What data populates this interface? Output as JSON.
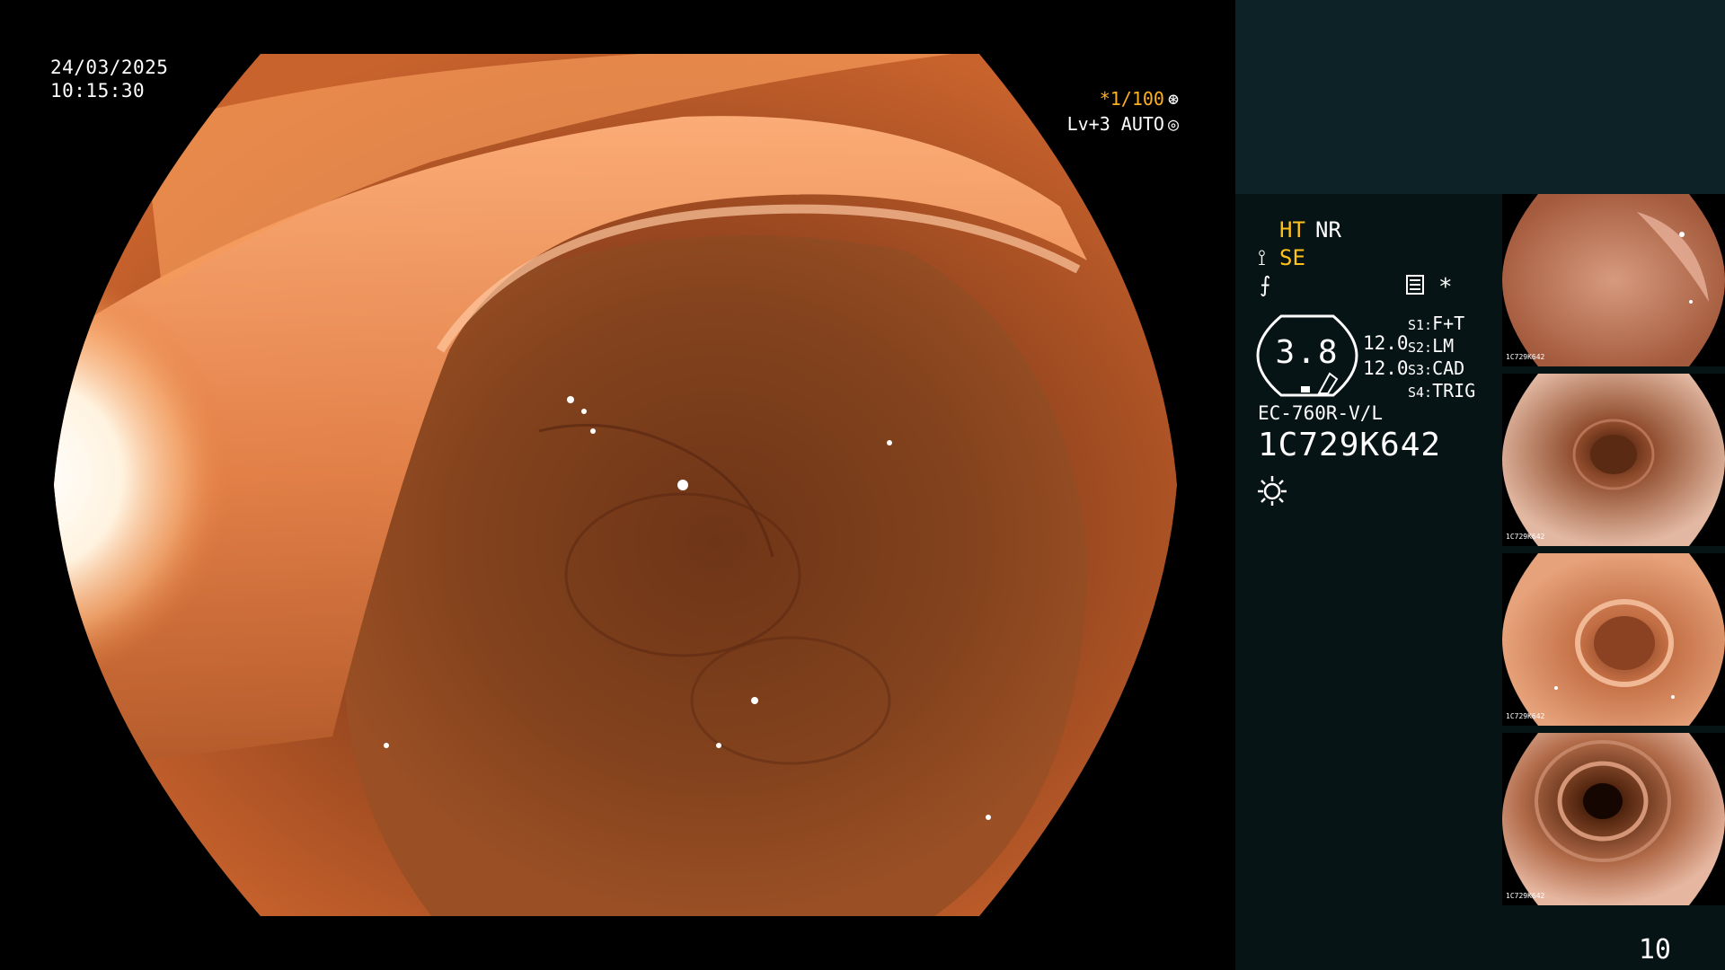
{
  "overlay": {
    "date": "24/03/2025",
    "time": "10:15:30",
    "shutter": "*1/100",
    "shutter_icon": "aperture-icon",
    "level": "Lv+3 AUTO",
    "level_icon": "iris-icon"
  },
  "status": {
    "ht": "HT",
    "nr": "NR",
    "se": "SE",
    "se_icon": "wand-icon",
    "f_icon": "f-icon",
    "star": "*",
    "gauge_value": "3.8",
    "num1": "12.0",
    "num2": "12.0",
    "settings": [
      {
        "key": "S1:",
        "value": "F+T"
      },
      {
        "key": "S2:",
        "value": "LM"
      },
      {
        "key": "S3:",
        "value": "CAD"
      },
      {
        "key": "S4:",
        "value": "TRIG"
      }
    ],
    "scope_model": "EC-760R-V/L",
    "serial": "1C729K642"
  },
  "thumbnails": [
    {
      "caption": "1C729K642"
    },
    {
      "caption": "1C729K642"
    },
    {
      "caption": "1C729K642"
    },
    {
      "caption": "1C729K642"
    }
  ],
  "page_number": "10",
  "colors": {
    "accent_yellow": "#ffc21a",
    "panel_top": "#0d2226",
    "panel_bottom": "#071416",
    "tissue": "#b0562a"
  }
}
